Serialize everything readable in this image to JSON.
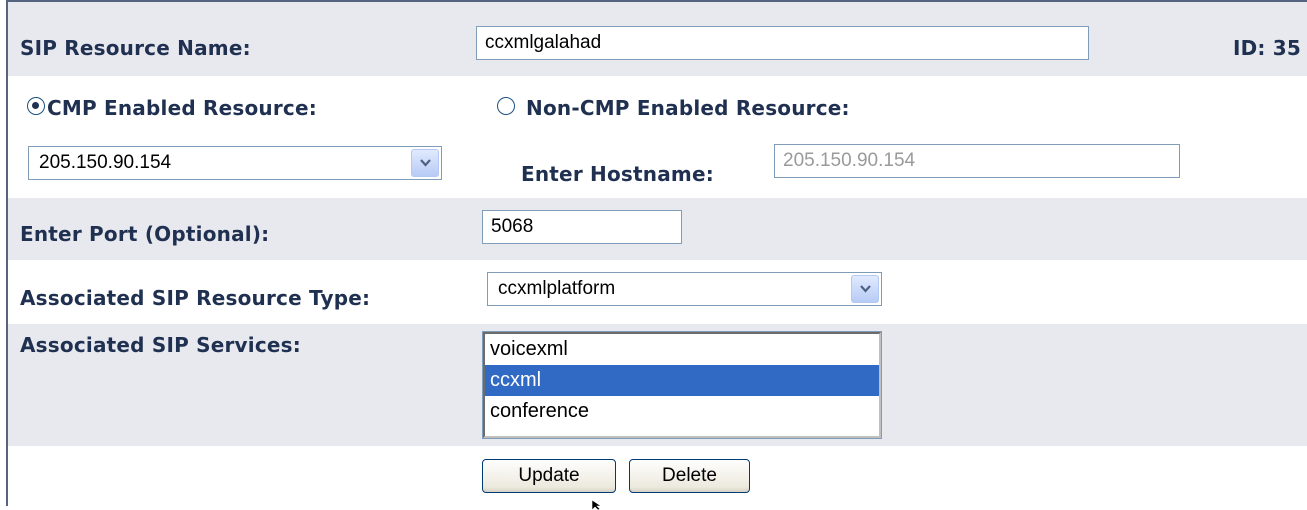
{
  "form": {
    "resource_name": {
      "label": "SIP Resource Name:",
      "value": "ccxmlgalahad",
      "id_text": "ID: 35"
    },
    "radio_cmp": {
      "label": "CMP Enabled Resource:",
      "selected": true
    },
    "radio_noncmp": {
      "label": "Non-CMP Enabled Resource:",
      "selected": false
    },
    "cmp_select": {
      "value": "205.150.90.154"
    },
    "hostname": {
      "label": "Enter Hostname:",
      "value": "205.150.90.154"
    },
    "port": {
      "label": "Enter Port (Optional):",
      "value": "5068"
    },
    "resource_type": {
      "label": "Associated SIP Resource Type:",
      "value": "ccxmlplatform"
    },
    "services": {
      "label": "Associated SIP Services:",
      "options": [
        "voicexml",
        "ccxml",
        "conference"
      ],
      "selected": "ccxml"
    },
    "buttons": {
      "update": "Update",
      "delete": "Delete"
    }
  },
  "colors": {
    "row_shade": "#e8e9ef",
    "label_text": "#1f3050",
    "selection": "#316ac5",
    "input_border": "#7f9db9"
  },
  "icons": {
    "dropdown": "chevron-down-icon",
    "cursor": "mouse-pointer-icon"
  }
}
